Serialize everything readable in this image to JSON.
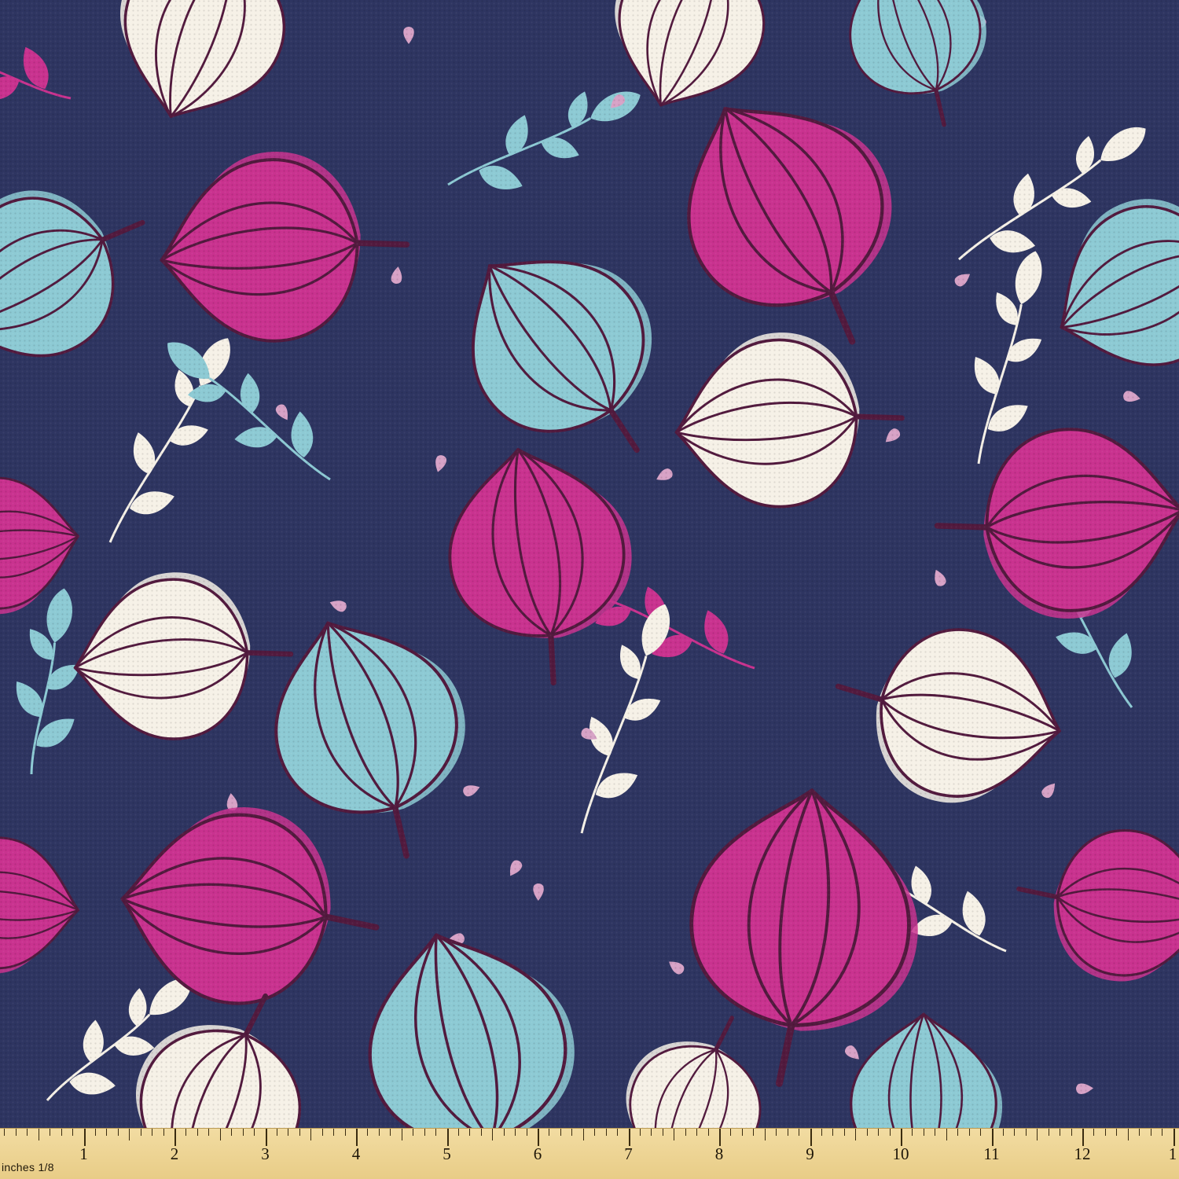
{
  "colors": {
    "background": "#2e3561",
    "magenta": "#c9328f",
    "teal": "#8dcad4",
    "cream": "#f6f1e7",
    "stroke": "#521a3e",
    "seed": "#d7a2c6"
  },
  "ruler": {
    "unit_label": "inches 1/8",
    "numbers": [
      "1",
      "2",
      "3",
      "4",
      "5",
      "6",
      "7",
      "8",
      "9",
      "10",
      "11",
      "12",
      "1"
    ]
  }
}
